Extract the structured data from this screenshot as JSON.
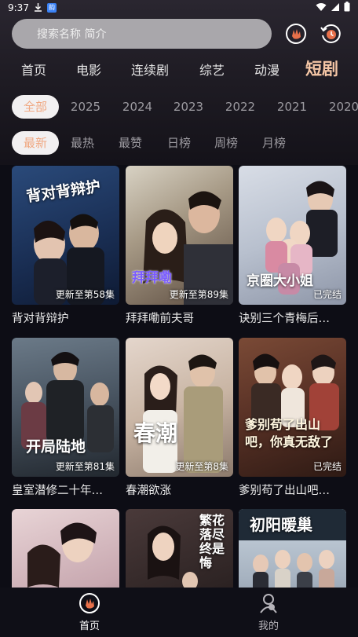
{
  "status": {
    "time": "9:37",
    "download_icon": "download-icon",
    "app_badge": "韵"
  },
  "search": {
    "placeholder": "搜索名称 简介"
  },
  "nav_tabs": [
    {
      "label": "首页"
    },
    {
      "label": "电影"
    },
    {
      "label": "连续剧"
    },
    {
      "label": "综艺"
    },
    {
      "label": "动漫"
    },
    {
      "label": "短剧"
    }
  ],
  "year_filters": [
    {
      "label": "全部"
    },
    {
      "label": "2025"
    },
    {
      "label": "2024"
    },
    {
      "label": "2023"
    },
    {
      "label": "2022"
    },
    {
      "label": "2021"
    },
    {
      "label": "2020"
    }
  ],
  "sort_filters": [
    {
      "label": "最新"
    },
    {
      "label": "最热"
    },
    {
      "label": "最赞"
    },
    {
      "label": "日榜"
    },
    {
      "label": "周榜"
    },
    {
      "label": "月榜"
    }
  ],
  "cards": [
    {
      "title": "背对背辩护",
      "tag": "更新至第58集",
      "art": "背对背辩护"
    },
    {
      "title": "拜拜嘞前夫哥",
      "tag": "更新至第89集",
      "art": "拜拜嘞"
    },
    {
      "title": "诀别三个青梅后…",
      "tag": "已完结",
      "art": "京圈大小姐"
    },
    {
      "title": "皇室潜修二十年…",
      "tag": "更新至第81集",
      "art": "开局陆地"
    },
    {
      "title": "春潮欲涨",
      "tag": "更新至第8集",
      "art": "春潮"
    },
    {
      "title": "爹别苟了出山吧…",
      "tag": "已完结",
      "art": "爹别苟了出山吧，你真无敌了"
    },
    {
      "title": "",
      "tag": "",
      "art": ""
    },
    {
      "title": "",
      "tag": "",
      "art": "繁花落尽终是悔"
    },
    {
      "title": "",
      "tag": "",
      "art": "初阳暖巢"
    }
  ],
  "bottom_nav": [
    {
      "label": "首页",
      "icon": "home-icon"
    },
    {
      "label": "我的",
      "icon": "profile-icon"
    }
  ],
  "colors": {
    "accent": "#f6c7a6",
    "chip_active_text": "#f0a882"
  }
}
